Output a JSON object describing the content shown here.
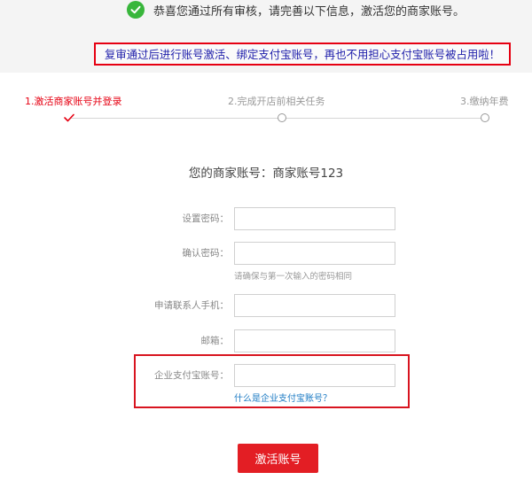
{
  "header": {
    "success_message": "恭喜您通过所有审核，请完善以下信息，激活您的商家账号。",
    "notice": "复审通过后进行账号激活、绑定支付宝账号，再也不用担心支付宝账号被占用啦！"
  },
  "steps": [
    {
      "label": "1.激活商家账号并登录",
      "status": "done"
    },
    {
      "label": "2.完成开店前相关任务",
      "status": "pending"
    },
    {
      "label": "3.缴纳年费",
      "status": "pending"
    }
  ],
  "colors": {
    "accent": "#e60012",
    "success": "#38b63b",
    "link": "#1979c3"
  },
  "merchant_line": "您的商家账号：商家账号123",
  "form": {
    "password_label": "设置密码：",
    "password_value": "",
    "confirm_label": "确认密码：",
    "confirm_value": "",
    "confirm_hint": "请确保与第一次输入的密码相同",
    "phone_label": "申请联系人手机：",
    "phone_value": "",
    "email_label": "邮箱：",
    "email_value": "",
    "alipay_label": "企业支付宝账号：",
    "alipay_value": "",
    "alipay_link": "什么是企业支付宝账号？"
  },
  "activate_button": "激活账号"
}
